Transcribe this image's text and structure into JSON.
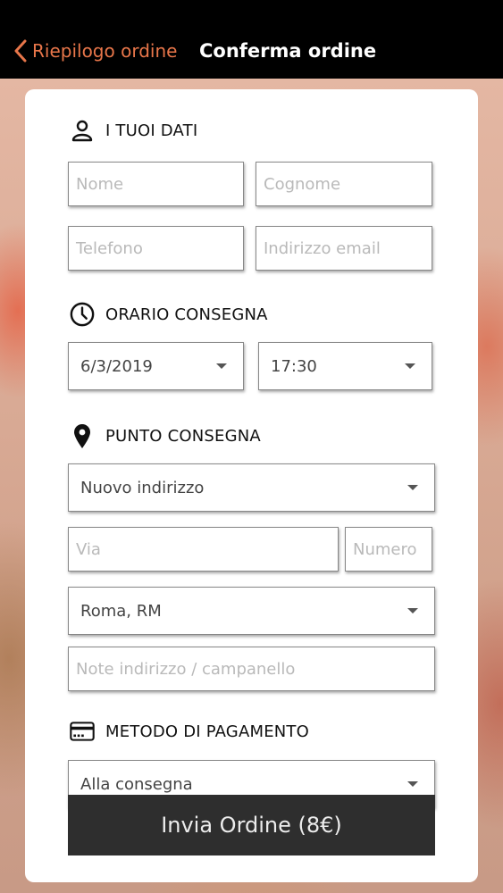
{
  "header": {
    "back_label": "Riepilogo ordine",
    "title": "Conferma ordine",
    "accent_color": "#e8764a"
  },
  "sections": {
    "personal": {
      "title": "I TUOI DATI",
      "icon": "person-icon",
      "name_placeholder": "Nome",
      "surname_placeholder": "Cognome",
      "phone_placeholder": "Telefono",
      "email_placeholder": "Indirizzo email"
    },
    "delivery_time": {
      "title": "ORARIO CONSEGNA",
      "icon": "clock-icon",
      "date_value": "6/3/2019",
      "time_value": "17:30"
    },
    "delivery_point": {
      "title": "PUNTO CONSEGNA",
      "icon": "location-pin-icon",
      "address_select_value": "Nuovo indirizzo",
      "street_placeholder": "Via",
      "number_placeholder": "Numero",
      "city_select_value": "Roma, RM",
      "notes_placeholder": "Note indirizzo / campanello"
    },
    "payment": {
      "title": "METODO DI PAGAMENTO",
      "icon": "credit-card-icon",
      "method_value": "Alla consegna"
    }
  },
  "submit": {
    "label": "Invia Ordine (8€)"
  }
}
